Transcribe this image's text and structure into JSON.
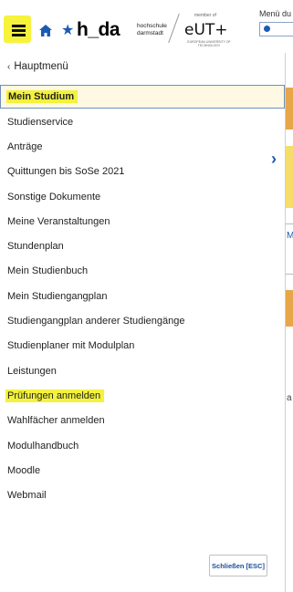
{
  "header": {
    "logo_main": "h_da",
    "logo_sub_line1": "hochschule",
    "logo_sub_line2": "darmstadt",
    "eut_small_top": "member of",
    "eut_main": "eUT+",
    "eut_small_bottom": "EUROPEAN UNIVERSITY OF TECHNOLOGY",
    "menu_label": "Menü du"
  },
  "panel": {
    "back_label": "Hauptmenü",
    "items": [
      {
        "label": "Mein Studium"
      },
      {
        "label": "Studienservice"
      },
      {
        "label": "Anträge"
      },
      {
        "label": "Quittungen bis SoSe 2021"
      },
      {
        "label": "Sonstige Dokumente"
      },
      {
        "label": "Meine Veranstaltungen"
      },
      {
        "label": "Stundenplan"
      },
      {
        "label": "Mein Studienbuch"
      },
      {
        "label": "Mein Studiengangplan"
      },
      {
        "label": "Studiengangplan anderer Studiengänge"
      },
      {
        "label": "Studienplaner mit Modulplan"
      },
      {
        "label": "Leistungen"
      },
      {
        "label": "Prüfungen anmelden"
      },
      {
        "label": "Wahlfächer anmelden"
      },
      {
        "label": "Modulhandbuch"
      },
      {
        "label": "Moodle"
      },
      {
        "label": "Webmail"
      }
    ],
    "close_label": "Schließen [ESC]"
  },
  "background": {
    "letter_m": "M",
    "letter_a": "a"
  },
  "icons": {
    "menu": "hamburger-icon",
    "home": "home-icon",
    "favorite": "star-icon",
    "back": "chevron-left-icon",
    "next": "chevron-right-icon"
  },
  "colors": {
    "highlight": "#f4f23c",
    "brand_blue": "#1a5bb3",
    "active_bg": "#fff8e2"
  }
}
